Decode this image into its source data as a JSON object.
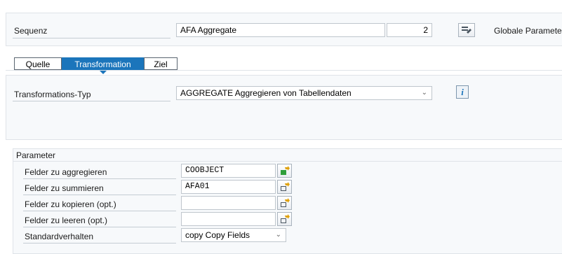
{
  "header": {
    "sequenz_label": "Sequenz",
    "sequenz_value": "AFA Aggregate",
    "sequenz_number": "2",
    "globale_parameter_label": "Globale Parameter"
  },
  "tabs": [
    {
      "label": "Quelle",
      "active": false
    },
    {
      "label": "Transformation",
      "active": true
    },
    {
      "label": "Ziel",
      "active": false
    }
  ],
  "transformation": {
    "typ_label": "Transformations-Typ",
    "typ_value": "AGGREGATE Aggregieren von Tabellendaten"
  },
  "parameter": {
    "title": "Parameter",
    "rows": [
      {
        "label": "Felder zu aggregieren",
        "value": "COOBJECT",
        "icon": "assign-green-icon"
      },
      {
        "label": "Felder zu summieren",
        "value": "AFA01",
        "icon": "assign-icon"
      },
      {
        "label": "Felder zu kopieren (opt.)",
        "value": "",
        "icon": "assign-icon"
      },
      {
        "label": "Felder zu leeren (opt.)",
        "value": "",
        "icon": "assign-icon"
      }
    ],
    "standard_label": "Standardverhalten",
    "standard_value": "copy Copy Fields"
  },
  "colors": {
    "accent": "#1b75bb",
    "panel_bg": "#f7f9fb"
  }
}
